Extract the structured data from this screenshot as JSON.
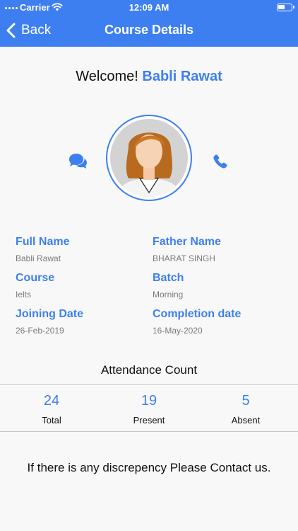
{
  "status_bar": {
    "carrier": "Carrier",
    "time": "12:09 AM"
  },
  "nav": {
    "back_label": "Back",
    "title": "Course Details"
  },
  "welcome": {
    "greeting": "Welcome!",
    "name": "Babli Rawat"
  },
  "details": {
    "full_name_label": "Full Name",
    "full_name_value": "Babli Rawat",
    "father_name_label": "Father Name",
    "father_name_value": "BHARAT SINGH",
    "course_label": "Course",
    "course_value": "Ielts",
    "batch_label": "Batch",
    "batch_value": "Morning",
    "joining_date_label": "Joining Date",
    "joining_date_value": "26-Feb-2019",
    "completion_date_label": "Completion date",
    "completion_date_value": "16-May-2020"
  },
  "attendance": {
    "title": "Attendance Count",
    "total_value": "24",
    "total_label": "Total",
    "present_value": "19",
    "present_label": "Present",
    "absent_value": "5",
    "absent_label": "Absent"
  },
  "footer": {
    "message": "If there is any discrepency Please Contact us."
  },
  "colors": {
    "accent": "#3d7ff0",
    "header_bg": "#3d7ff0",
    "page_bg": "#f8f8f8",
    "muted_text": "#7a7a7a"
  },
  "icons": {
    "back": "chevron-left-icon",
    "chat": "chat-bubbles-icon",
    "phone": "phone-icon",
    "wifi": "wifi-icon",
    "battery": "battery-icon"
  }
}
